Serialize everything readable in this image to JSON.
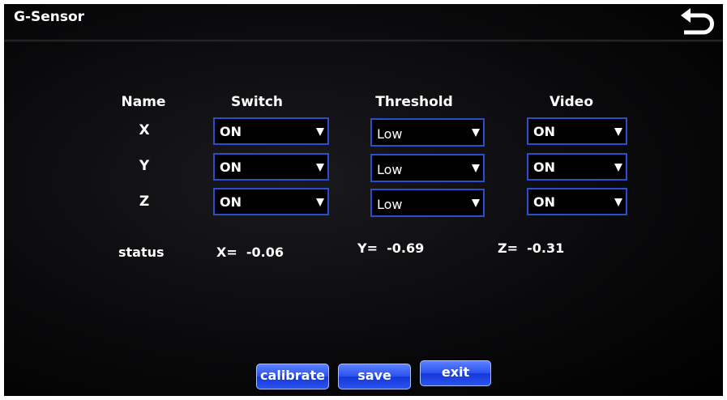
{
  "window": {
    "title": "G-Sensor"
  },
  "colors": {
    "accent": "#2b4ecf",
    "button": "#2a50ef",
    "background": "#000000"
  },
  "icons": {
    "back": "return-arrow-icon",
    "dropdown": "dropdown-arrow-icon"
  },
  "table": {
    "headers": {
      "name": "Name",
      "switch": "Switch",
      "threshold": "Threshold",
      "video": "Video"
    },
    "rows": [
      {
        "name": "X",
        "switch": "ON",
        "threshold": "Low",
        "video": "ON"
      },
      {
        "name": "Y",
        "switch": "ON",
        "threshold": "Low",
        "video": "ON"
      },
      {
        "name": "Z",
        "switch": "ON",
        "threshold": "Low",
        "video": "ON"
      }
    ]
  },
  "status": {
    "label": "status",
    "x": "X=  -0.06",
    "y": "Y=  -0.69",
    "z": "Z=  -0.31"
  },
  "buttons": {
    "calibrate": "calibrate",
    "save": "save",
    "exit": "exit"
  }
}
